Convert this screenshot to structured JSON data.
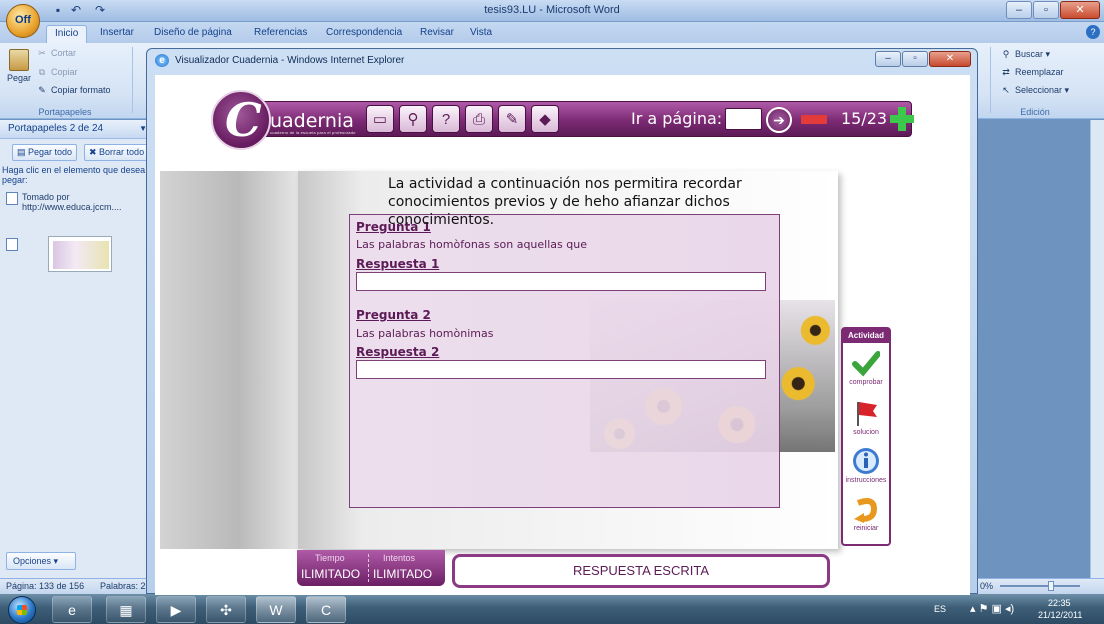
{
  "word": {
    "title": "tesis93.LU - Microsoft Word",
    "tabs": [
      "Inicio",
      "Insertar",
      "Diseño de página",
      "Referencias",
      "Correspondencia",
      "Revisar",
      "Vista"
    ],
    "clipboard_group": {
      "paste": "Pegar",
      "cut": "Cortar",
      "copy": "Copiar",
      "format_painter": "Copiar formato",
      "label": "Portapapeles"
    },
    "edit_group": {
      "find": "Buscar",
      "replace": "Reemplazar",
      "select": "Seleccionar",
      "label": "Edición"
    },
    "clipboard_pane": {
      "title": "Portapapeles 2 de 24",
      "paste_all": "Pegar todo",
      "clear_all": "Borrar todo",
      "hint": "Haga clic en el elemento que desea pegar:",
      "item_line1": "Tomado por",
      "item_line2": "http://www.educa.jccm....",
      "options": "Opciones"
    },
    "status": {
      "page": "Página: 133 de 156",
      "words": "Palabras: 2",
      "zoom": "0%"
    }
  },
  "ie": {
    "title": "Visualizador Cuadernia - Windows Internet Explorer"
  },
  "cuadernia": {
    "brand": "uadernia",
    "brand_tagline": "cuaderno de la escuela para el profesorado",
    "go_to_page_label": "Ir a página:",
    "page_count": "15/23",
    "intro_text": "La actividad a continuación nos permitira  recordar conocimientos previos y de heho afianzar  dichos conocimientos.",
    "questions": [
      {
        "label": "Pregunta 1",
        "text": "Las palabras homòfonas son  aquellas que",
        "answer_label": "Respuesta 1",
        "answer": ""
      },
      {
        "label": "Pregunta 2",
        "text": "Las palabras homònimas",
        "answer_label": "Respuesta 2",
        "answer": ""
      }
    ],
    "activity_panel": {
      "title": "Actividad",
      "check": "comprobar",
      "solution": "solucion",
      "instructions": "instrucciones",
      "restart": "reiniciar"
    },
    "time_label": "Tiempo",
    "time_value": "ILIMITADO",
    "attempts_label": "Intentos",
    "attempts_value": "ILIMITADO",
    "activity_type": "RESPUESTA ESCRITA"
  },
  "tray": {
    "lang": "ES",
    "time": "22:35",
    "date": "21/12/2011"
  }
}
